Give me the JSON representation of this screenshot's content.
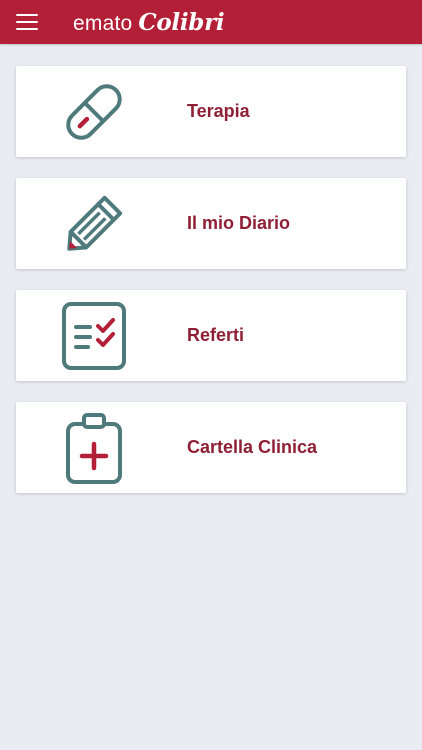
{
  "app": {
    "brand_prefix": "emato",
    "brand_name": "Colibri"
  },
  "colors": {
    "header": "#b21f36",
    "accent_text": "#8e1f35",
    "icon_teal": "#4f7a7b",
    "icon_red": "#b21f36",
    "background": "#e9edf1"
  },
  "menu": {
    "items": [
      {
        "label": "Terapia",
        "icon": "pill-icon"
      },
      {
        "label": "Il mio Diario",
        "icon": "pencil-icon"
      },
      {
        "label": "Referti",
        "icon": "checklist-icon"
      },
      {
        "label": "Cartella Clinica",
        "icon": "medical-clipboard-icon"
      }
    ]
  }
}
